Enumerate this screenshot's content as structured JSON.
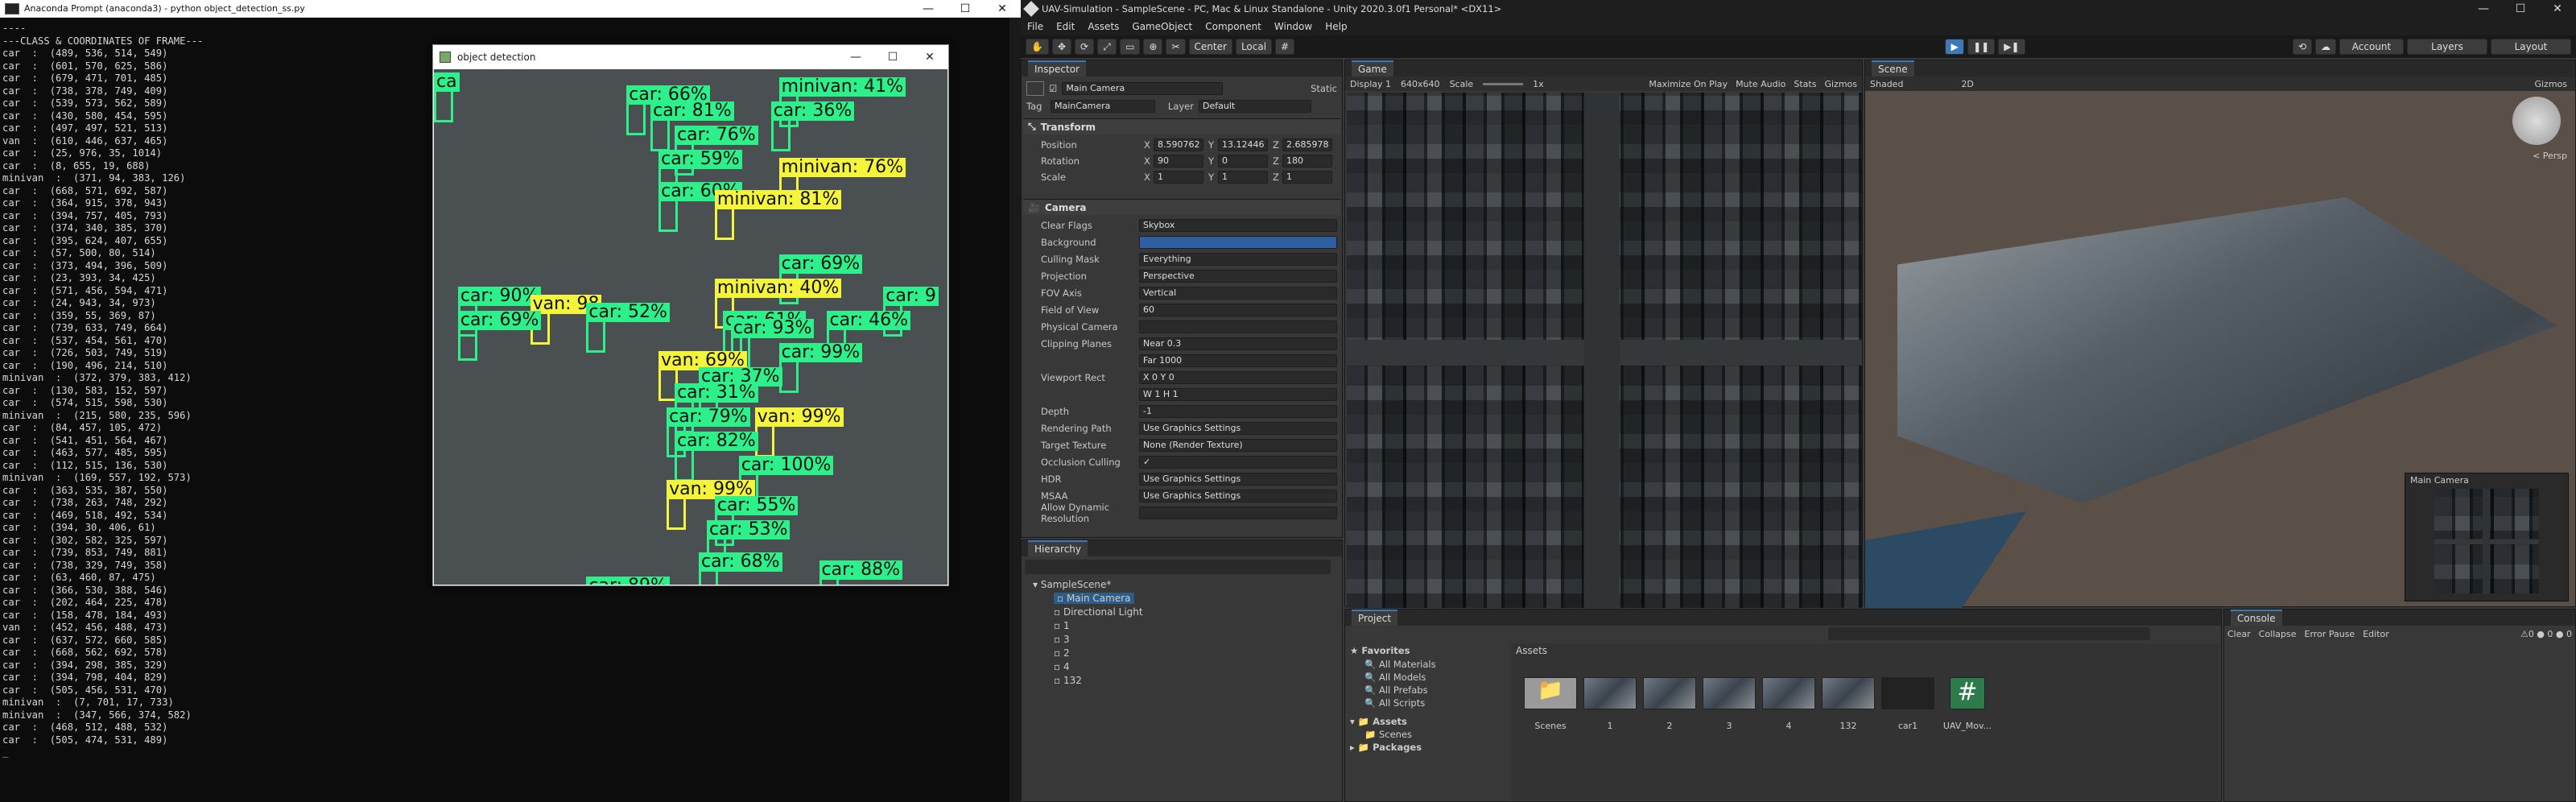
{
  "anaconda": {
    "title": "Anaconda Prompt (anaconda3) - python  object_detection_ss.py",
    "lines": [
      "----",
      "---CLASS & COORDINATES OF FRAME---",
      "car  :  (489, 536, 514, 549)",
      "car  :  (601, 570, 625, 586)",
      "car  :  (679, 471, 701, 485)",
      "car  :  (738, 378, 749, 409)",
      "car  :  (539, 573, 562, 589)",
      "car  :  (430, 580, 454, 595)",
      "car  :  (497, 497, 521, 513)",
      "van  :  (610, 446, 637, 465)",
      "car  :  (25, 976, 35, 1014)",
      "car  :  (8, 655, 19, 688)",
      "minivan  :  (371, 94, 383, 126)",
      "car  :  (668, 571, 692, 587)",
      "car  :  (364, 915, 378, 943)",
      "car  :  (394, 757, 405, 793)",
      "car  :  (374, 340, 385, 370)",
      "car  :  (395, 624, 407, 655)",
      "car  :  (57, 500, 80, 514)",
      "car  :  (373, 494, 396, 509)",
      "car  :  (23, 393, 34, 425)",
      "car  :  (571, 456, 594, 471)",
      "car  :  (24, 943, 34, 973)",
      "car  :  (359, 55, 369, 87)",
      "car  :  (739, 633, 749, 664)",
      "car  :  (537, 454, 561, 470)",
      "car  :  (726, 503, 749, 519)",
      "car  :  (190, 496, 214, 510)",
      "minivan  :  (372, 379, 383, 412)",
      "car  :  (130, 583, 152, 597)",
      "car  :  (574, 515, 598, 530)",
      "minivan  :  (215, 580, 235, 596)",
      "car  :  (84, 457, 105, 472)",
      "car  :  (541, 451, 564, 467)",
      "car  :  (463, 577, 485, 595)",
      "car  :  (112, 515, 136, 530)",
      "minivan  :  (169, 557, 192, 573)",
      "car  :  (363, 535, 387, 550)",
      "car  :  (738, 263, 748, 292)",
      "car  :  (469, 518, 492, 534)",
      "car  :  (394, 30, 406, 61)",
      "car  :  (302, 582, 325, 597)",
      "car  :  (739, 853, 749, 881)",
      "car  :  (738, 329, 749, 358)",
      "car  :  (63, 460, 87, 475)",
      "car  :  (366, 530, 388, 546)",
      "car  :  (202, 464, 225, 478)",
      "car  :  (158, 478, 184, 493)",
      "van  :  (452, 456, 488, 473)",
      "car  :  (637, 572, 660, 585)",
      "car  :  (668, 562, 692, 578)",
      "car  :  (394, 298, 385, 329)",
      "car  :  (394, 798, 404, 829)",
      "car  :  (505, 456, 531, 470)",
      "minivan  :  (7, 701, 17, 733)",
      "minivan  :  (347, 566, 374, 582)",
      "car  :  (468, 512, 488, 532)",
      "car  :  (505, 474, 531, 489)"
    ]
  },
  "detection": {
    "title": "object detection",
    "labels": [
      {
        "t": "ca",
        "c": "g"
      },
      {
        "t": "car: 66%",
        "c": "g"
      },
      {
        "t": "minivan: 41%",
        "c": "g"
      },
      {
        "t": "car: 81%",
        "c": "g"
      },
      {
        "t": "car: 36%",
        "c": "g"
      },
      {
        "t": "car: 76%",
        "c": "g"
      },
      {
        "t": "car: 59%",
        "c": "g"
      },
      {
        "t": "minivan: 76%",
        "c": "y"
      },
      {
        "t": "car: 60%",
        "c": "g"
      },
      {
        "t": "minivan: 81%",
        "c": "y"
      },
      {
        "t": "car: 69%",
        "c": "g"
      },
      {
        "t": "minivan: 40%",
        "c": "y"
      },
      {
        "t": "car: 90%",
        "c": "g"
      },
      {
        "t": "van: 98",
        "c": "y"
      },
      {
        "t": "car: 52%",
        "c": "g"
      },
      {
        "t": "car: 61%",
        "c": "g"
      },
      {
        "t": "car: 9",
        "c": "g"
      },
      {
        "t": "car: 69%",
        "c": "g"
      },
      {
        "t": "car: 93%",
        "c": "g"
      },
      {
        "t": "car: 46%",
        "c": "g"
      },
      {
        "t": "car: 99%",
        "c": "g"
      },
      {
        "t": "van: 69%",
        "c": "y"
      },
      {
        "t": "car: 37%",
        "c": "g"
      },
      {
        "t": "car: 31%",
        "c": "g"
      },
      {
        "t": "car: 79%",
        "c": "g"
      },
      {
        "t": "van: 99%",
        "c": "y"
      },
      {
        "t": "car: 82%",
        "c": "g"
      },
      {
        "t": "car: 100%",
        "c": "g"
      },
      {
        "t": "van: 99%",
        "c": "y"
      },
      {
        "t": "car: 55%",
        "c": "g"
      },
      {
        "t": "car: 53%",
        "c": "g"
      },
      {
        "t": "car: 68%",
        "c": "g"
      },
      {
        "t": "car: 88%",
        "c": "g"
      },
      {
        "t": "car: 89%",
        "c": "g"
      },
      {
        "t": "car: 69%",
        "c": "g"
      }
    ]
  },
  "unity": {
    "title": "UAV-Simulation - SampleScene - PC, Mac & Linux Standalone - Unity 2020.3.0f1 Personal* <DX11>",
    "menu": [
      "File",
      "Edit",
      "Assets",
      "GameObject",
      "Component",
      "Window",
      "Help"
    ],
    "toolbar": {
      "center": "Center",
      "local": "Local",
      "account": "Account",
      "layers": "Layers",
      "layout": "Layout"
    },
    "inspector": {
      "tab": "Inspector",
      "object": "Main Camera",
      "static": "Static",
      "tag_label": "Tag",
      "tag": "MainCamera",
      "layer_label": "Layer",
      "layer": "Default",
      "transform": "Transform",
      "position": "Position",
      "pos": [
        "8.590762",
        "13.12446",
        "2.685978"
      ],
      "rotation": "Rotation",
      "rot": [
        "90",
        "0",
        "180"
      ],
      "scale": "Scale",
      "scl": [
        "1",
        "1",
        "1"
      ],
      "camera": "Camera",
      "rows": [
        [
          "Clear Flags",
          "Skybox"
        ],
        [
          "Background",
          ""
        ],
        [
          "Culling Mask",
          "Everything"
        ],
        [
          "Projection",
          "Perspective"
        ],
        [
          "FOV Axis",
          "Vertical"
        ],
        [
          "Field of View",
          "60"
        ],
        [
          "Physical Camera",
          ""
        ],
        [
          "Clipping Planes",
          "Near  0.3"
        ],
        [
          "",
          "Far   1000"
        ],
        [
          "Viewport Rect",
          "X 0      Y 0"
        ],
        [
          "",
          "W 1      H 1"
        ],
        [
          "Depth",
          "-1"
        ],
        [
          "Rendering Path",
          "Use Graphics Settings"
        ],
        [
          "Target Texture",
          "None (Render Texture)"
        ],
        [
          "Occlusion Culling",
          "✓"
        ],
        [
          "HDR",
          "Use Graphics Settings"
        ],
        [
          "MSAA",
          "Use Graphics Settings"
        ],
        [
          "Allow Dynamic Resolution",
          ""
        ]
      ]
    },
    "hierarchy": {
      "tab": "Hierarchy",
      "items": [
        "SampleScene*",
        "Main Camera",
        "Directional Light",
        "1",
        "3",
        "2",
        "4",
        "132"
      ]
    },
    "game": {
      "tab": "Game",
      "display": "Display 1",
      "res": "640x640",
      "scale": "Scale",
      "scale_val": "1x",
      "opts": [
        "Maximize On Play",
        "Mute Audio",
        "Stats",
        "Gizmos"
      ]
    },
    "scene": {
      "tab": "Scene",
      "shaded": "Shaded",
      "mode": "2D",
      "gizmos": "Gizmos",
      "persp": "< Persp",
      "preview": "Main Camera"
    },
    "project": {
      "tab": "Project",
      "favorites": "Favorites",
      "fav_items": [
        "All Materials",
        "All Models",
        "All Prefabs",
        "All Scripts"
      ],
      "assets": "Assets",
      "asset_tree": [
        "Scenes"
      ],
      "packages": "Packages",
      "grid_title": "Assets",
      "assets_grid": [
        "Scenes",
        "1",
        "2",
        "3",
        "4",
        "132",
        "car1",
        "UAV_Mov..."
      ]
    },
    "console": {
      "tab": "Console",
      "buttons": [
        "Clear",
        "Collapse",
        "Error Pause",
        "Editor"
      ],
      "counts": [
        "0",
        "0",
        "0"
      ]
    }
  }
}
